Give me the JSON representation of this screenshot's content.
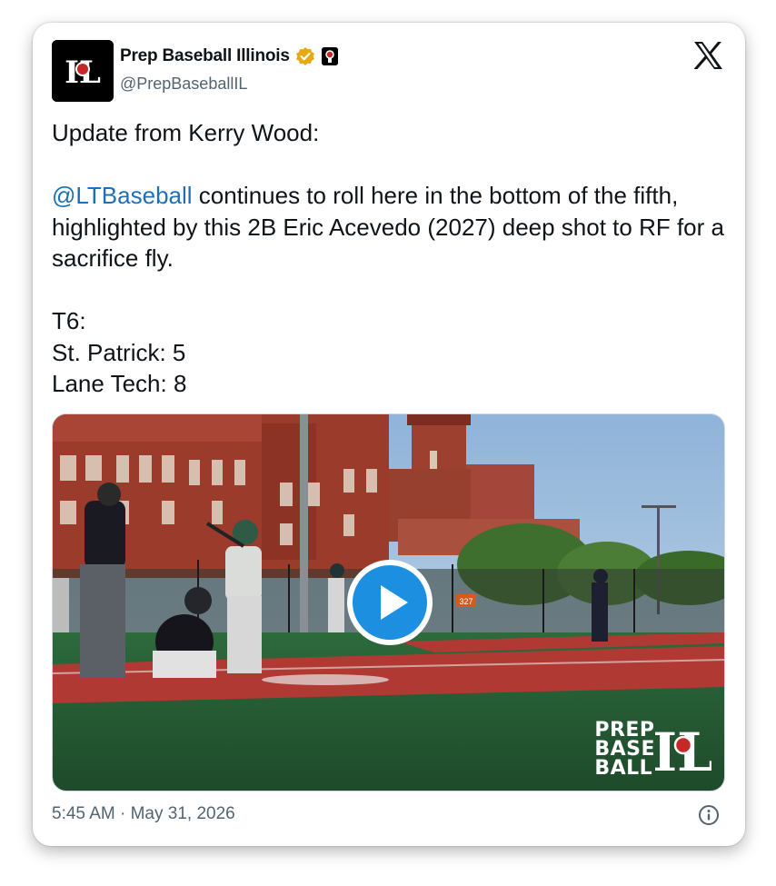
{
  "account": {
    "display_name": "Prep Baseball Illinois",
    "handle": "@PrepBaseballIL",
    "avatar_text": "IL",
    "verified": true,
    "badge_color": "#f4b400"
  },
  "tweet": {
    "intro": "Update from Kerry Wood:",
    "mention": "@LTBaseball",
    "body": " continues to roll here in the bottom of the fifth, highlighted by this 2B Eric Acevedo (2027) deep shot to RF for a sacrifice fly.",
    "score_lines": [
      "T6:",
      "St. Patrick: 5",
      "Lane Tech: 8"
    ],
    "mention_color": "#1d70b8"
  },
  "media": {
    "type": "video",
    "play_icon": "play-icon",
    "watermark": [
      "PREP",
      "BASE",
      "BALL"
    ],
    "watermark_logo": "IL",
    "scoreboard_sign": "327"
  },
  "footer": {
    "timestamp": "5:45 AM · May 31, 2026",
    "info_icon": "info-icon"
  },
  "brand": {
    "platform_icon": "x-logo-icon"
  }
}
